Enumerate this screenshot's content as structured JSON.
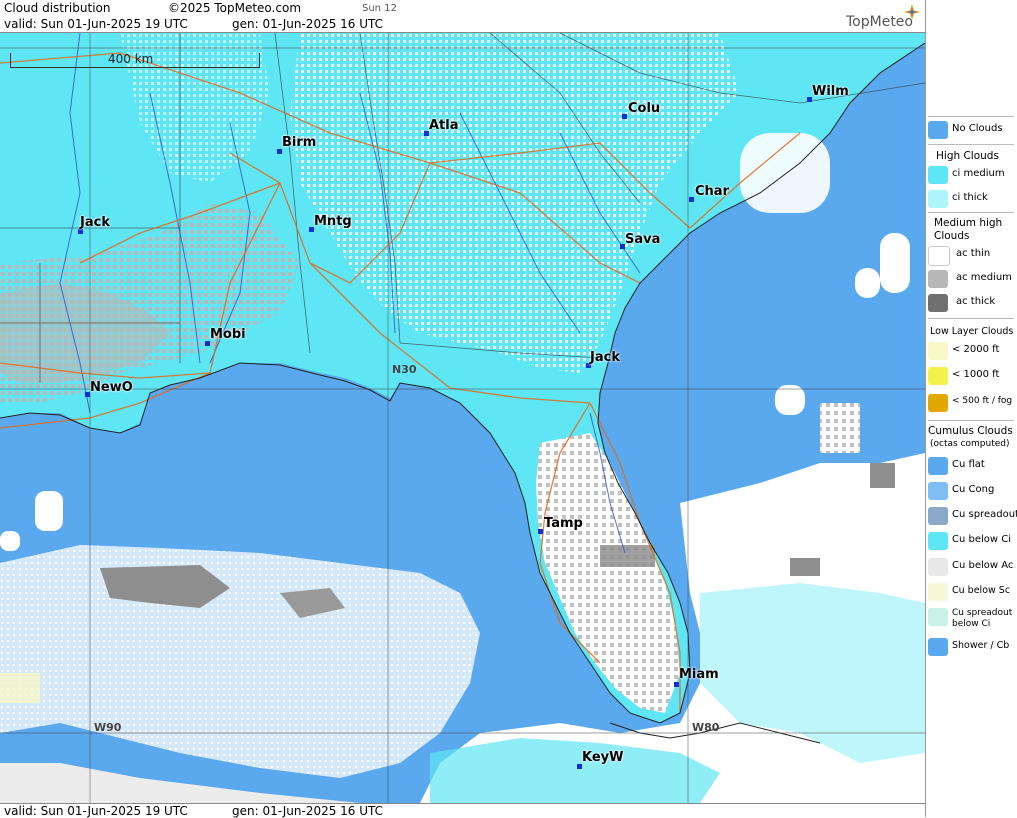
{
  "header": {
    "title": "Cloud distribution",
    "copyright": "©2025 TopMeteo.com",
    "day_code": "Sun 12",
    "valid_line": "valid:  Sun  01-Jun-2025  19 UTC",
    "gen_line": "gen: 01-Jun-2025 16 UTC",
    "brand": "TopMeteo"
  },
  "footer": {
    "valid_line": "valid:  Sun  01-Jun-2025  19 UTC",
    "gen_line": "gen: 01-Jun-2025 16 UTC"
  },
  "map": {
    "scale_label": "400 km",
    "cities": [
      {
        "name": "Wilm"
      },
      {
        "name": "Colu"
      },
      {
        "name": "Atla"
      },
      {
        "name": "Birm"
      },
      {
        "name": "Char"
      },
      {
        "name": "Jack"
      },
      {
        "name": "Mntg"
      },
      {
        "name": "Sava"
      },
      {
        "name": "Mobi"
      },
      {
        "name": "Jack"
      },
      {
        "name": "NewO"
      },
      {
        "name": "Tamp"
      },
      {
        "name": "Miam"
      },
      {
        "name": "KeyW"
      }
    ],
    "grid_labels": [
      "N30",
      "W90",
      "W80"
    ],
    "colors": {
      "sea": "#5aa8ee",
      "high_cloud": "#5fe6f4",
      "medium_cloud": "#b8b8b8",
      "white_cloud": "#ffffff"
    }
  },
  "legend": {
    "no_clouds": "No Clouds",
    "high_title": "High Clouds",
    "ci_medium": "ci medium",
    "ci_thick": "ci thick",
    "medium_title": "Medium high Clouds",
    "ac_thin": "ac thin",
    "ac_medium": "ac medium",
    "ac_thick": "ac thick",
    "low_title": "Low Layer Clouds",
    "low_2000": "< 2000 ft",
    "low_1000": "< 1000 ft",
    "low_500": "< 500 ft / fog",
    "cu_title": "Cumulus Clouds",
    "cu_sub": "(octas computed)",
    "cu_flat": "Cu flat",
    "cu_cong": "Cu Cong",
    "cu_spread": "Cu spreadout",
    "cu_below_ci": "Cu below Ci",
    "cu_below_ac": "Cu below Ac",
    "cu_below_sc": "Cu below Sc",
    "cu_spread_ci": "Cu spreadout below Ci",
    "shower": "Shower / Cb"
  }
}
